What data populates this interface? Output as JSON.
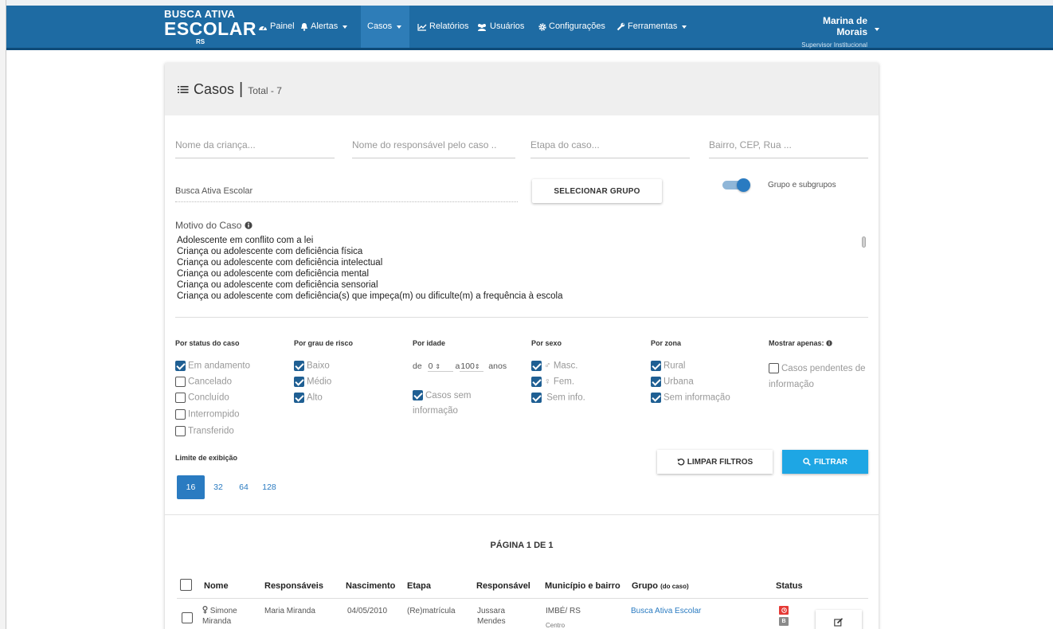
{
  "nav": {
    "logo_line1": "BUSCA ATIVA",
    "logo_line2": "ESCOLAR",
    "logo_line3": "RS",
    "items": [
      {
        "label": "Painel",
        "icon": "dashboard-icon"
      },
      {
        "label": "Alertas",
        "icon": "bell-icon"
      },
      {
        "label": "Casos",
        "icon": ""
      },
      {
        "label": "Relatórios",
        "icon": "chart-icon"
      },
      {
        "label": "Usuários",
        "icon": "users-icon"
      },
      {
        "label": "Configurações",
        "icon": "gear-icon"
      },
      {
        "label": "Ferramentas",
        "icon": "wrench-icon"
      }
    ],
    "user_name": "Marina de Morais",
    "user_role": "Supervisor Institucional"
  },
  "header": {
    "title": "Casos",
    "total": "Total - 7"
  },
  "filters": {
    "nome_crianca_placeholder": "Nome da criança...",
    "nome_responsavel_placeholder": "Nome do responsável pelo caso ..",
    "etapa_placeholder": "Etapa do caso...",
    "endereco_placeholder": "Bairro, CEP, Rua ...",
    "grupo_value": "Busca Ativa Escolar",
    "selecionar_grupo_label": "SELECIONAR GRUPO",
    "subgrupos_label": "Grupo e subgrupos",
    "motivo_label": "Motivo do Caso",
    "motivos": [
      "Adolescente em conflito com a lei",
      "Criança ou adolescente com deficiência física",
      "Criança ou adolescente com deficiência intelectual",
      "Criança ou adolescente com deficiência mental",
      "Criança ou adolescente com deficiência sensorial",
      "Criança ou adolescente com deficiência(s) que impeça(m) ou dificulte(m) a frequência à escola"
    ],
    "status_title": "Por status do caso",
    "status": [
      {
        "label": "Em andamento",
        "checked": true
      },
      {
        "label": "Cancelado",
        "checked": false
      },
      {
        "label": "Concluído",
        "checked": false
      },
      {
        "label": "Interrompido",
        "checked": false
      },
      {
        "label": "Transferido",
        "checked": false
      }
    ],
    "risco_title": "Por grau de risco",
    "risco": [
      {
        "label": "Baixo",
        "checked": true
      },
      {
        "label": "Médio",
        "checked": true
      },
      {
        "label": "Alto",
        "checked": true
      }
    ],
    "idade_title": "Por idade",
    "idade_de": "de",
    "idade_min": "0",
    "idade_a": "a",
    "idade_max": "100",
    "idade_unit": "anos",
    "idade_sem_info": "Casos sem informação",
    "sexo_title": "Por sexo",
    "sexo": [
      {
        "label": "♂ Masc.",
        "checked": true
      },
      {
        "label": "♀ Fem.",
        "checked": true
      },
      {
        "label": "Sem info.",
        "checked": true
      }
    ],
    "zona_title": "Por zona",
    "zona": [
      {
        "label": "Rural",
        "checked": true
      },
      {
        "label": "Urbana",
        "checked": true
      },
      {
        "label": "Sem informação",
        "checked": true
      }
    ],
    "mostrar_title": "Mostrar apenas:",
    "pendentes_label": "Casos pendentes de informação",
    "limite_title": "Limite de exibição",
    "limites": [
      "16",
      "32",
      "64",
      "128"
    ],
    "limite_selected": "16",
    "limpar_label": "LIMPAR FILTROS",
    "filtrar_label": "FILTRAR"
  },
  "table": {
    "pagination": "PÁGINA 1 DE 1",
    "headers": {
      "nome": "Nome",
      "responsaveis": "Responsáveis",
      "nascimento": "Nascimento",
      "etapa": "Etapa",
      "responsavel": "Responsável",
      "municipio": "Município e bairro",
      "grupo": "Grupo",
      "grupo_small": "(do caso)",
      "status": "Status"
    },
    "rows": [
      {
        "nome_line1": "Simone",
        "nome_line2": "Miranda",
        "responsaveis": "Maria Miranda",
        "nascimento": "04/05/2010",
        "etapa": "(Re)matrícula",
        "responsavel_line1": "Jussara",
        "responsavel_line2": "Mendes",
        "municipio": "IMBÉ/ RS",
        "bairro": "Centro",
        "grupo": "Busca Ativa Escolar",
        "status_badge2": "B"
      }
    ]
  },
  "colors": {
    "navbar": "#1e6ba3",
    "accent": "#2a7bc1",
    "filtrar": "#1ea6e4",
    "checkbox": "#1f5f93",
    "status_red": "#e53935",
    "status_gray": "#8a8a8a"
  }
}
